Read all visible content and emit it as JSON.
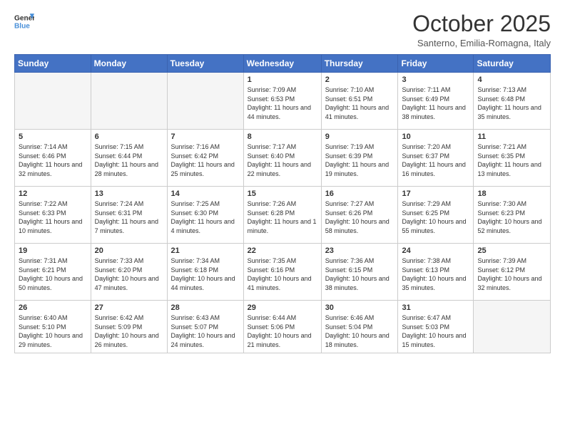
{
  "header": {
    "logo_line1": "General",
    "logo_line2": "Blue",
    "main_title": "October 2025",
    "subtitle": "Santerno, Emilia-Romagna, Italy"
  },
  "days_of_week": [
    "Sunday",
    "Monday",
    "Tuesday",
    "Wednesday",
    "Thursday",
    "Friday",
    "Saturday"
  ],
  "weeks": [
    [
      {
        "day": "",
        "empty": true
      },
      {
        "day": "",
        "empty": true
      },
      {
        "day": "",
        "empty": true
      },
      {
        "day": "1",
        "sunrise": "7:09 AM",
        "sunset": "6:53 PM",
        "daylight": "11 hours and 44 minutes."
      },
      {
        "day": "2",
        "sunrise": "7:10 AM",
        "sunset": "6:51 PM",
        "daylight": "11 hours and 41 minutes."
      },
      {
        "day": "3",
        "sunrise": "7:11 AM",
        "sunset": "6:49 PM",
        "daylight": "11 hours and 38 minutes."
      },
      {
        "day": "4",
        "sunrise": "7:13 AM",
        "sunset": "6:48 PM",
        "daylight": "11 hours and 35 minutes."
      }
    ],
    [
      {
        "day": "5",
        "sunrise": "7:14 AM",
        "sunset": "6:46 PM",
        "daylight": "11 hours and 32 minutes."
      },
      {
        "day": "6",
        "sunrise": "7:15 AM",
        "sunset": "6:44 PM",
        "daylight": "11 hours and 28 minutes."
      },
      {
        "day": "7",
        "sunrise": "7:16 AM",
        "sunset": "6:42 PM",
        "daylight": "11 hours and 25 minutes."
      },
      {
        "day": "8",
        "sunrise": "7:17 AM",
        "sunset": "6:40 PM",
        "daylight": "11 hours and 22 minutes."
      },
      {
        "day": "9",
        "sunrise": "7:19 AM",
        "sunset": "6:39 PM",
        "daylight": "11 hours and 19 minutes."
      },
      {
        "day": "10",
        "sunrise": "7:20 AM",
        "sunset": "6:37 PM",
        "daylight": "11 hours and 16 minutes."
      },
      {
        "day": "11",
        "sunrise": "7:21 AM",
        "sunset": "6:35 PM",
        "daylight": "11 hours and 13 minutes."
      }
    ],
    [
      {
        "day": "12",
        "sunrise": "7:22 AM",
        "sunset": "6:33 PM",
        "daylight": "11 hours and 10 minutes."
      },
      {
        "day": "13",
        "sunrise": "7:24 AM",
        "sunset": "6:31 PM",
        "daylight": "11 hours and 7 minutes."
      },
      {
        "day": "14",
        "sunrise": "7:25 AM",
        "sunset": "6:30 PM",
        "daylight": "11 hours and 4 minutes."
      },
      {
        "day": "15",
        "sunrise": "7:26 AM",
        "sunset": "6:28 PM",
        "daylight": "11 hours and 1 minute."
      },
      {
        "day": "16",
        "sunrise": "7:27 AM",
        "sunset": "6:26 PM",
        "daylight": "10 hours and 58 minutes."
      },
      {
        "day": "17",
        "sunrise": "7:29 AM",
        "sunset": "6:25 PM",
        "daylight": "10 hours and 55 minutes."
      },
      {
        "day": "18",
        "sunrise": "7:30 AM",
        "sunset": "6:23 PM",
        "daylight": "10 hours and 52 minutes."
      }
    ],
    [
      {
        "day": "19",
        "sunrise": "7:31 AM",
        "sunset": "6:21 PM",
        "daylight": "10 hours and 50 minutes."
      },
      {
        "day": "20",
        "sunrise": "7:33 AM",
        "sunset": "6:20 PM",
        "daylight": "10 hours and 47 minutes."
      },
      {
        "day": "21",
        "sunrise": "7:34 AM",
        "sunset": "6:18 PM",
        "daylight": "10 hours and 44 minutes."
      },
      {
        "day": "22",
        "sunrise": "7:35 AM",
        "sunset": "6:16 PM",
        "daylight": "10 hours and 41 minutes."
      },
      {
        "day": "23",
        "sunrise": "7:36 AM",
        "sunset": "6:15 PM",
        "daylight": "10 hours and 38 minutes."
      },
      {
        "day": "24",
        "sunrise": "7:38 AM",
        "sunset": "6:13 PM",
        "daylight": "10 hours and 35 minutes."
      },
      {
        "day": "25",
        "sunrise": "7:39 AM",
        "sunset": "6:12 PM",
        "daylight": "10 hours and 32 minutes."
      }
    ],
    [
      {
        "day": "26",
        "sunrise": "6:40 AM",
        "sunset": "5:10 PM",
        "daylight": "10 hours and 29 minutes."
      },
      {
        "day": "27",
        "sunrise": "6:42 AM",
        "sunset": "5:09 PM",
        "daylight": "10 hours and 26 minutes."
      },
      {
        "day": "28",
        "sunrise": "6:43 AM",
        "sunset": "5:07 PM",
        "daylight": "10 hours and 24 minutes."
      },
      {
        "day": "29",
        "sunrise": "6:44 AM",
        "sunset": "5:06 PM",
        "daylight": "10 hours and 21 minutes."
      },
      {
        "day": "30",
        "sunrise": "6:46 AM",
        "sunset": "5:04 PM",
        "daylight": "10 hours and 18 minutes."
      },
      {
        "day": "31",
        "sunrise": "6:47 AM",
        "sunset": "5:03 PM",
        "daylight": "10 hours and 15 minutes."
      },
      {
        "day": "",
        "empty": true
      }
    ]
  ]
}
